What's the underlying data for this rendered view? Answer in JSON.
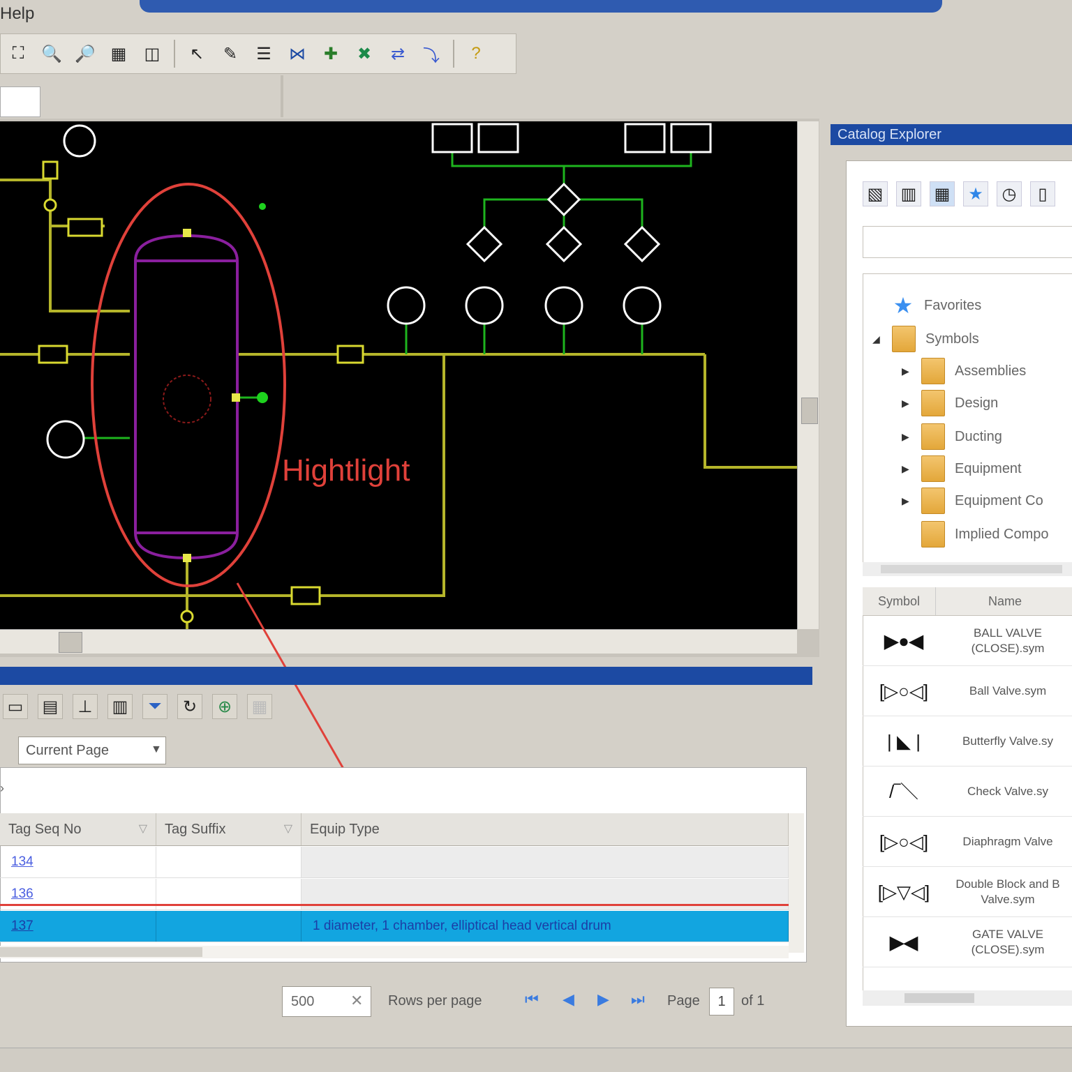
{
  "menu": {
    "help_label": "Help"
  },
  "toolbar": {
    "icons": [
      "zoom-extents-icon",
      "zoom-in-icon",
      "zoom-out-icon",
      "zoom-window-icon",
      "zoom-previous-icon",
      "select-icon",
      "find-icon",
      "properties-icon",
      "insert-valve-icon",
      "insert-instrument-icon",
      "connect-icon",
      "swap-icon",
      "flow-icon",
      "help-icon"
    ]
  },
  "canvas": {
    "highlight_label": "Hightlight",
    "colors": {
      "background": "#000000",
      "vessel": "#8a1f9e",
      "pipe": "#b5b52a",
      "signal": "#1eb41e",
      "highlight": "#e0413a"
    }
  },
  "data_manager": {
    "scope": "Current Page",
    "columns": [
      {
        "label": "Tag Seq No"
      },
      {
        "label": "Tag Suffix"
      },
      {
        "label": "Equip Type"
      }
    ],
    "rows": [
      {
        "tag_seq": "134",
        "tag_suffix": "",
        "equip_type": ""
      },
      {
        "tag_seq": "136",
        "tag_suffix": "",
        "equip_type": ""
      },
      {
        "tag_seq": "137",
        "tag_suffix": "",
        "equip_type": "1 diameter, 1 chamber, elliptical head vertical drum"
      }
    ],
    "paging": {
      "rows_per_page_value": "500",
      "rows_per_page_label": "Rows per page",
      "page_label": "Page",
      "page_value": "1",
      "of_label": "of 1"
    }
  },
  "catalog": {
    "title": "Catalog Explorer",
    "tree": [
      {
        "label": "Favorites",
        "kind": "star"
      },
      {
        "label": "Symbols",
        "kind": "folder",
        "expanded": true
      },
      {
        "label": "Assemblies",
        "kind": "folder"
      },
      {
        "label": "Design",
        "kind": "folder"
      },
      {
        "label": "Ducting",
        "kind": "folder"
      },
      {
        "label": "Equipment",
        "kind": "folder"
      },
      {
        "label": "Equipment Co",
        "kind": "folder"
      },
      {
        "label": "Implied Compo",
        "kind": "folder"
      }
    ],
    "symbol_columns": {
      "symbol": "Symbol",
      "name": "Name"
    },
    "symbols": [
      {
        "glyph": "▶●◀",
        "name": "BALL VALVE (CLOSE).sym"
      },
      {
        "glyph": "[▷○◁]",
        "name": "Ball Valve.sym"
      },
      {
        "glyph": "| ◣ |",
        "name": "Butterfly Valve.sy"
      },
      {
        "glyph": "/‾＼",
        "name": "Check Valve.sy"
      },
      {
        "glyph": "[▷○◁]",
        "name": "Diaphragm Valve"
      },
      {
        "glyph": "[▷▽◁]",
        "name": "Double Block and B Valve.sym"
      },
      {
        "glyph": "▶◀",
        "name": "GATE VALVE (CLOSE).sym"
      }
    ]
  }
}
